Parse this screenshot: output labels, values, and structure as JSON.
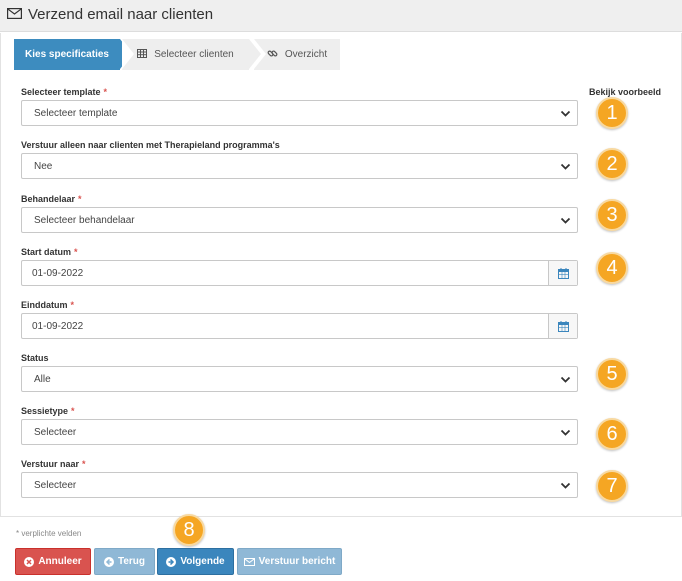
{
  "header": {
    "title": "Verzend email naar clienten",
    "icon": "envelope-icon"
  },
  "steps": [
    {
      "label": "Kies specificaties",
      "icon": ""
    },
    {
      "label": "Selecteer clienten",
      "icon": "table-icon"
    },
    {
      "label": "Overzicht",
      "icon": "link-icon"
    }
  ],
  "preview_label": "Bekijk voorbeeld",
  "fields": {
    "template": {
      "label": "Selecteer template",
      "value": "Selecteer template",
      "required": "*"
    },
    "therapieland": {
      "label": "Verstuur alleen naar clienten met Therapieland programma's",
      "value": "Nee"
    },
    "behandelaar": {
      "label": "Behandelaar",
      "value": "Selecteer behandelaar",
      "required": "*"
    },
    "start_datum": {
      "label": "Start datum",
      "value": "01-09-2022",
      "required": "*"
    },
    "einddatum": {
      "label": "Einddatum",
      "value": "01-09-2022",
      "required": "*"
    },
    "status": {
      "label": "Status",
      "value": "Alle"
    },
    "sessietype": {
      "label": "Sessietype",
      "value": "Selecteer",
      "required": "*"
    },
    "verstuur_naar": {
      "label": "Verstuur naar",
      "value": "Selecteer",
      "required": "*"
    }
  },
  "badges": [
    "1",
    "2",
    "3",
    "4",
    "5",
    "6",
    "7",
    "8"
  ],
  "badge_color": "#f5a623",
  "footnote": "* verplichte velden",
  "buttons": {
    "cancel": "Annuleer",
    "back": "Terug",
    "next": "Volgende",
    "send": "Verstuur bericht"
  },
  "colors": {
    "primary": "#3b86bd",
    "danger": "#d9534f",
    "disabled": "#8fb8d6",
    "required": "#d9534f"
  }
}
